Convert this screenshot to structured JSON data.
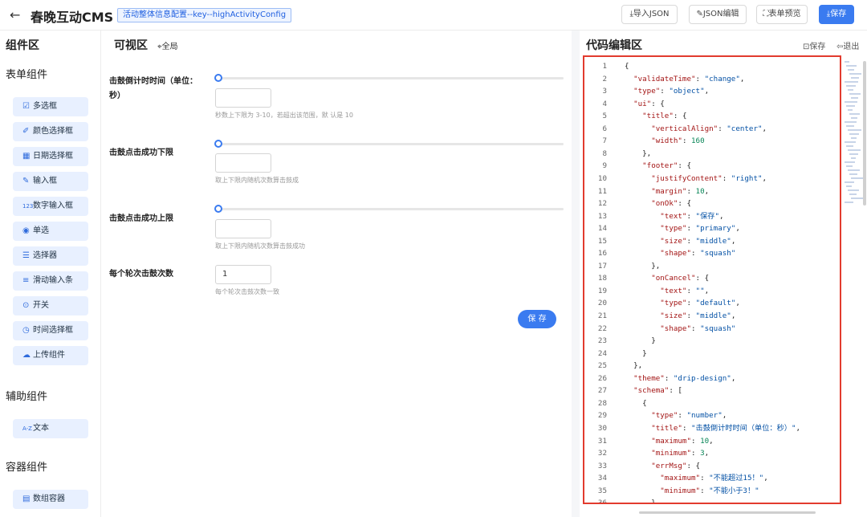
{
  "header": {
    "back_icon": "arrow-left-icon",
    "title": "春晚互动CMS",
    "config_tag": "活动整体信息配置--key--highActivityConfig",
    "buttons": [
      {
        "icon": "download-icon",
        "label": "导入JSON"
      },
      {
        "icon": "edit-icon",
        "label": "JSON编辑"
      },
      {
        "icon": "expand-icon",
        "label": "表单预览"
      },
      {
        "icon": "download-icon",
        "label": "保存"
      }
    ],
    "accent": "#3a7bf0"
  },
  "sidebar": {
    "title": "组件区",
    "sections": [
      {
        "title": "表单组件",
        "items": [
          {
            "label": "多选框",
            "icon": "checkbox-icon"
          },
          {
            "label": "颜色选择框",
            "icon": "brush-icon"
          },
          {
            "label": "日期选择框",
            "icon": "calendar-icon"
          },
          {
            "label": "输入框",
            "icon": "edit-box-icon"
          },
          {
            "label": "数字输入框",
            "icon": "number-icon"
          },
          {
            "label": "单选",
            "icon": "radio-icon"
          },
          {
            "label": "选择器",
            "icon": "list-icon"
          },
          {
            "label": "滑动输入条",
            "icon": "slider-icon"
          },
          {
            "label": "开关",
            "icon": "switch-icon"
          },
          {
            "label": "时间选择框",
            "icon": "clock-icon"
          },
          {
            "label": "上传组件",
            "icon": "cloud-upload-icon"
          }
        ]
      },
      {
        "title": "辅助组件",
        "items": [
          {
            "label": "文本",
            "icon": "text-az-icon"
          }
        ]
      },
      {
        "title": "容器组件",
        "items": [
          {
            "label": "数组容器",
            "icon": "array-icon"
          }
        ]
      }
    ]
  },
  "preview": {
    "title": "可视区",
    "global_label": "全局",
    "global_icon": "location-icon",
    "fields": [
      {
        "label": "击鼓倒计时时间（单位：秒）",
        "slider_value": 0,
        "value": "",
        "hint": "秒数上下限为 3-10，若超出该范围，默 认是 10"
      },
      {
        "label": "击鼓点击成功下限",
        "slider_value": 0,
        "value": "",
        "hint": "取上下限内随机次数算击鼓成"
      },
      {
        "label": "击鼓点击成功上限",
        "slider_value": 0,
        "value": "",
        "hint": "取上下限内随机次数算击鼓成功"
      },
      {
        "label": "每个轮次击鼓次数",
        "value": "1",
        "hint": "每个轮次击鼓次数一致"
      }
    ],
    "save_label": "保 存"
  },
  "editor": {
    "title": "代码编辑区",
    "save_label": "保存",
    "exit_label": "退出",
    "lines": [
      {
        "n": "1",
        "t": "{"
      },
      {
        "n": "2",
        "t": "  \"validateTime\": \"change\","
      },
      {
        "n": "3",
        "t": "  \"type\": \"object\","
      },
      {
        "n": "4",
        "t": "  \"ui\": {"
      },
      {
        "n": "5",
        "t": "    \"title\": {"
      },
      {
        "n": "6",
        "t": "      \"verticalAlign\": \"center\","
      },
      {
        "n": "7",
        "t": "      \"width\": 160"
      },
      {
        "n": "8",
        "t": "    },"
      },
      {
        "n": "9",
        "t": "    \"footer\": {"
      },
      {
        "n": "10",
        "t": "      \"justifyContent\": \"right\","
      },
      {
        "n": "11",
        "t": "      \"margin\": 10,"
      },
      {
        "n": "12",
        "t": "      \"onOk\": {"
      },
      {
        "n": "13",
        "t": "        \"text\": \"保存\","
      },
      {
        "n": "14",
        "t": "        \"type\": \"primary\","
      },
      {
        "n": "15",
        "t": "        \"size\": \"middle\","
      },
      {
        "n": "16",
        "t": "        \"shape\": \"squash\""
      },
      {
        "n": "17",
        "t": "      },"
      },
      {
        "n": "18",
        "t": "      \"onCancel\": {"
      },
      {
        "n": "19",
        "t": "        \"text\": \"\","
      },
      {
        "n": "20",
        "t": "        \"type\": \"default\","
      },
      {
        "n": "21",
        "t": "        \"size\": \"middle\","
      },
      {
        "n": "22",
        "t": "        \"shape\": \"squash\""
      },
      {
        "n": "23",
        "t": "      }"
      },
      {
        "n": "24",
        "t": "    }"
      },
      {
        "n": "25",
        "t": "  },"
      },
      {
        "n": "26",
        "t": "  \"theme\": \"drip-design\","
      },
      {
        "n": "27",
        "t": "  \"schema\": ["
      },
      {
        "n": "28",
        "t": "    {"
      },
      {
        "n": "29",
        "t": "      \"type\": \"number\","
      },
      {
        "n": "30",
        "t": "      \"title\": \"击鼓倒计时时间（单位：秒）\","
      },
      {
        "n": "31",
        "t": "      \"maximum\": 10,"
      },
      {
        "n": "32",
        "t": "      \"minimum\": 3,"
      },
      {
        "n": "33",
        "t": "      \"errMsg\": {"
      },
      {
        "n": "34",
        "t": "        \"maximum\": \"不能超过15！\","
      },
      {
        "n": "35",
        "t": "        \"minimum\": \"不能小于3！\""
      },
      {
        "n": "36",
        "t": "      },"
      }
    ],
    "highlight_color": "#e23b2e"
  }
}
